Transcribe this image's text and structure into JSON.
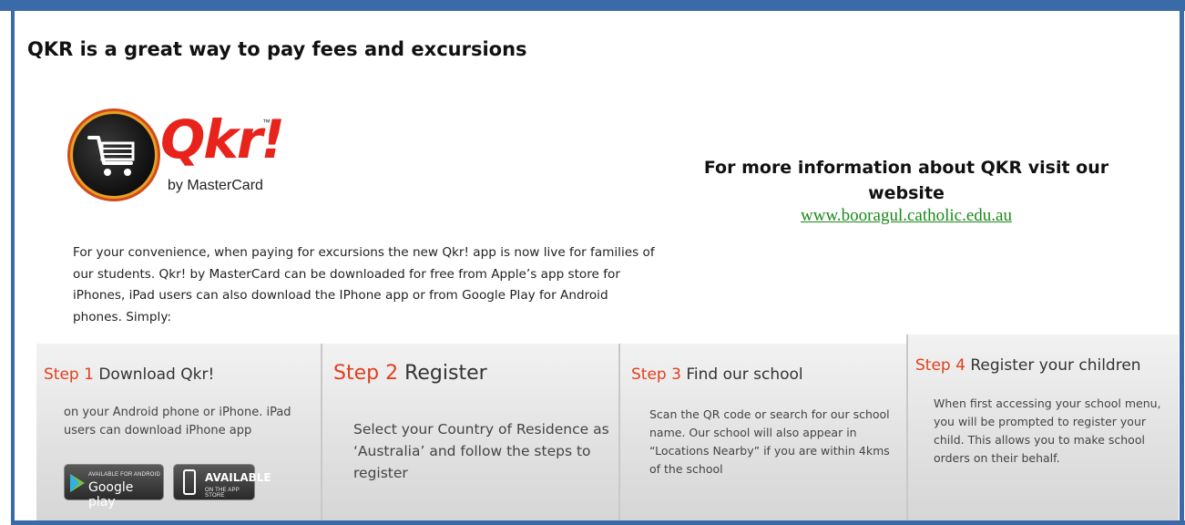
{
  "headline": "QKR is a great way to pay fees and excursions",
  "logo": {
    "word": "Qkr!",
    "tm": "™",
    "byline": "by MasterCard"
  },
  "info": {
    "heading": "For more information about QKR visit our website",
    "link": "www.booragul.catholic.edu.au"
  },
  "intro": "For your convenience, when paying for excursions the new Qkr! app is now live for families of our students. Qkr! by MasterCard can be downloaded for free from Apple’s app store for iPhones, iPad users can also download the IPhone app or from Google Play for Android phones.  Simply:",
  "steps": [
    {
      "num": "Step 1",
      "title": "Download Qkr!",
      "desc": "on your Android phone or iPhone. iPad users can download iPhone app"
    },
    {
      "num": "Step 2",
      "title": "Register",
      "desc": "Select your Country of Residence as ‘Australia’ and follow the steps to register"
    },
    {
      "num": "Step 3",
      "title": "Find our school",
      "desc": "Scan the QR code or search for our school name.  Our school will also appear in “Locations Nearby” if you are within 4kms of the school"
    },
    {
      "num": "Step 4",
      "title": "Register your children",
      "desc": "When first accessing your school menu, you will be prompted to register your child. This allows you to make school orders on their behalf."
    }
  ],
  "badges": {
    "google_small": "AVAILABLE FOR ANDROID",
    "google_big": "Google play",
    "apple_big": "AVAILABLE",
    "apple_small": "ON THE APP STORE"
  },
  "colors": {
    "frame": "#3a6aa8",
    "step_accent": "#e0401e",
    "brand_red": "#e8231c",
    "link": "#1a8a1a"
  }
}
